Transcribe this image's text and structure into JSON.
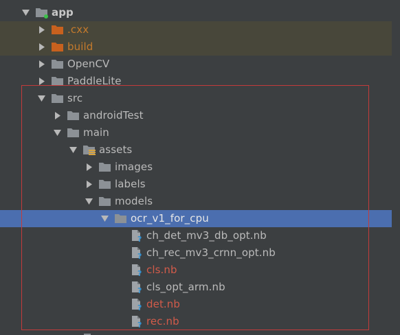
{
  "colors": {
    "background": "#3c3f41",
    "excluded_row": "#48473a",
    "selected_row": "#4b6eaf",
    "highlight_border": "#c43b3b",
    "text_default": "#bbbbbb",
    "text_excluded": "#c47a2c",
    "text_error": "#d25b4a",
    "folder_gray": "#8c9196",
    "folder_orange": "#c8621f"
  },
  "tree": [
    {
      "label": "app",
      "depth": 0,
      "arrow": "down",
      "icon": "module-folder-icon",
      "style": "bold",
      "row": "normal"
    },
    {
      "label": ".cxx",
      "depth": 1,
      "arrow": "right",
      "icon": "excluded-folder-icon",
      "style": "excl",
      "row": "excluded"
    },
    {
      "label": "build",
      "depth": 1,
      "arrow": "right",
      "icon": "excluded-folder-icon",
      "style": "excl",
      "row": "excluded"
    },
    {
      "label": "OpenCV",
      "depth": 1,
      "arrow": "right",
      "icon": "folder-icon",
      "style": "normal",
      "row": "normal"
    },
    {
      "label": "PaddleLite",
      "depth": 1,
      "arrow": "right",
      "icon": "folder-icon",
      "style": "normal",
      "row": "normal"
    },
    {
      "label": "src",
      "depth": 1,
      "arrow": "down",
      "icon": "folder-icon",
      "style": "normal",
      "row": "normal"
    },
    {
      "label": "androidTest",
      "depth": 2,
      "arrow": "right",
      "icon": "folder-icon",
      "style": "normal",
      "row": "normal"
    },
    {
      "label": "main",
      "depth": 2,
      "arrow": "down",
      "icon": "folder-icon",
      "style": "normal",
      "row": "normal"
    },
    {
      "label": "assets",
      "depth": 3,
      "arrow": "down",
      "icon": "resource-folder-icon",
      "style": "normal",
      "row": "normal"
    },
    {
      "label": "images",
      "depth": 4,
      "arrow": "right",
      "icon": "folder-icon",
      "style": "normal",
      "row": "normal"
    },
    {
      "label": "labels",
      "depth": 4,
      "arrow": "right",
      "icon": "folder-icon",
      "style": "normal",
      "row": "normal"
    },
    {
      "label": "models",
      "depth": 4,
      "arrow": "down",
      "icon": "folder-icon",
      "style": "normal",
      "row": "normal"
    },
    {
      "label": "ocr_v1_for_cpu",
      "depth": 5,
      "arrow": "down",
      "icon": "folder-icon",
      "style": "sel",
      "row": "selected"
    },
    {
      "label": "ch_det_mv3_db_opt.nb",
      "depth": 6,
      "arrow": "none",
      "icon": "unknown-file-icon",
      "style": "normal",
      "row": "normal"
    },
    {
      "label": "ch_rec_mv3_crnn_opt.nb",
      "depth": 6,
      "arrow": "none",
      "icon": "unknown-file-icon",
      "style": "normal",
      "row": "normal"
    },
    {
      "label": "cls.nb",
      "depth": 6,
      "arrow": "none",
      "icon": "unknown-file-icon",
      "style": "err",
      "row": "normal"
    },
    {
      "label": "cls_opt_arm.nb",
      "depth": 6,
      "arrow": "none",
      "icon": "unknown-file-icon",
      "style": "normal",
      "row": "normal"
    },
    {
      "label": "det.nb",
      "depth": 6,
      "arrow": "none",
      "icon": "unknown-file-icon",
      "style": "err",
      "row": "normal"
    },
    {
      "label": "rec.nb",
      "depth": 6,
      "arrow": "none",
      "icon": "unknown-file-icon",
      "style": "err",
      "row": "normal"
    }
  ]
}
